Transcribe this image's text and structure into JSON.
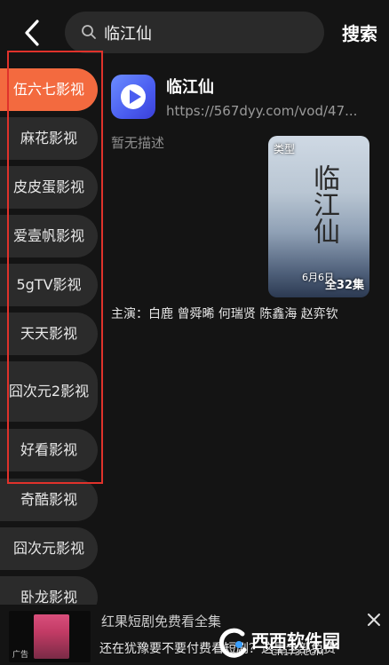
{
  "header": {
    "search_text": "临江仙",
    "search_button": "搜索"
  },
  "sidebar": {
    "items": [
      {
        "label": "伍六七影视",
        "active": true
      },
      {
        "label": "麻花影视"
      },
      {
        "label": "皮皮蛋影视"
      },
      {
        "label": "爱壹帆影视"
      },
      {
        "label": "5gTV影视"
      },
      {
        "label": "天天影视"
      },
      {
        "label": "囧次元2影视"
      },
      {
        "label": "好看影视"
      },
      {
        "label": "奇酷影视"
      },
      {
        "label": "囧次元影视"
      },
      {
        "label": "卧龙影视"
      }
    ],
    "highlight_color": "#e0322b",
    "active_color": "#f36a3f"
  },
  "result": {
    "title": "临江仙",
    "url": "https://567dyy.com/vod/47...",
    "description": "暂无描述",
    "poster": {
      "label": "类型",
      "art_text": "临江仙",
      "date_text": "6月6日",
      "episodes": "全32集"
    },
    "cast": "主演：白鹿 曾舜晞 何瑞贤 陈鑫海 赵弈钦"
  },
  "ad": {
    "title": "红果短剧免费看全集",
    "subtitle": "还在犹豫要不要付费看短剧？这里全部免费",
    "tag": "广告"
  },
  "watermark": {
    "text": "西西软件园",
    "url": "CR173.COM"
  }
}
